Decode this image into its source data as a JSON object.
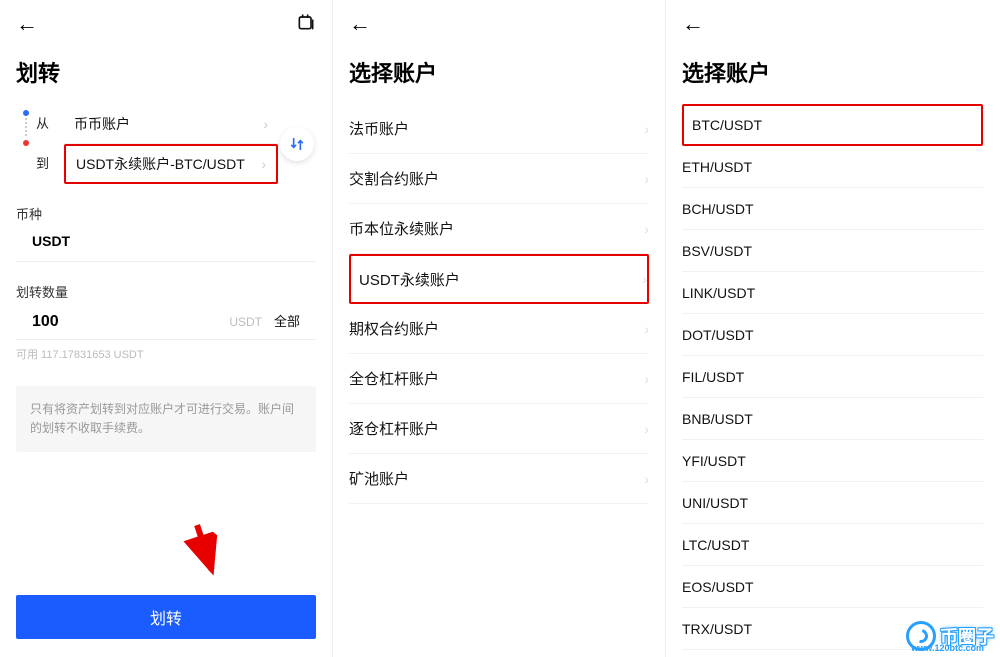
{
  "screen1": {
    "title": "划转",
    "from_label": "从",
    "to_label": "到",
    "from_account": "币币账户",
    "to_account": "USDT永续账户-BTC/USDT",
    "currency_section": "币种",
    "currency_value": "USDT",
    "amount_section": "划转数量",
    "amount_value": "100",
    "amount_unit": "USDT",
    "amount_all": "全部",
    "available": "可用 117.17831653 USDT",
    "info": "只有将资产划转到对应账户才可进行交易。账户间的划转不收取手续费。",
    "button": "划转"
  },
  "screen2": {
    "title": "选择账户",
    "items": [
      "法币账户",
      "交割合约账户",
      "币本位永续账户",
      "USDT永续账户",
      "期权合约账户",
      "全仓杠杆账户",
      "逐仓杠杆账户",
      "矿池账户"
    ],
    "highlight_index": 3
  },
  "screen3": {
    "title": "选择账户",
    "items": [
      "BTC/USDT",
      "ETH/USDT",
      "BCH/USDT",
      "BSV/USDT",
      "LINK/USDT",
      "DOT/USDT",
      "FIL/USDT",
      "BNB/USDT",
      "YFI/USDT",
      "UNI/USDT",
      "LTC/USDT",
      "EOS/USDT",
      "TRX/USDT"
    ],
    "highlight_index": 0
  },
  "watermark": {
    "brand": "币圈子",
    "url": "www.120btc.com"
  }
}
